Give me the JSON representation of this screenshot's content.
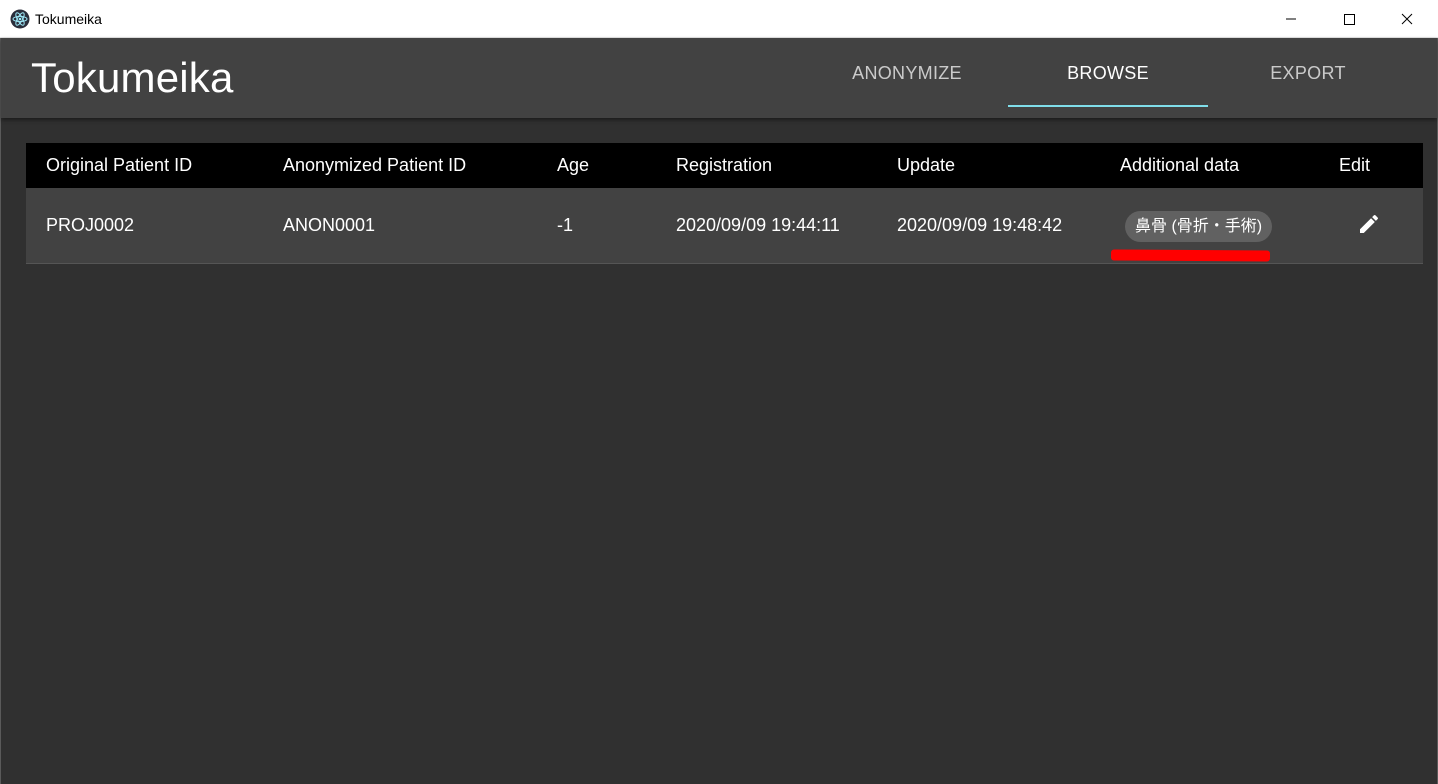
{
  "window": {
    "title": "Tokumeika",
    "icon": "electron-atom-icon",
    "controls": [
      "minimize",
      "maximize",
      "close"
    ]
  },
  "header": {
    "brand": "Tokumeika",
    "tabs": [
      {
        "label": "ANONYMIZE",
        "active": false
      },
      {
        "label": "BROWSE",
        "active": true
      },
      {
        "label": "EXPORT",
        "active": false
      }
    ],
    "indicator_color": "#80deea"
  },
  "table": {
    "columns": [
      "Original Patient ID",
      "Anonymized Patient ID",
      "Age",
      "Registration",
      "Update",
      "Additional data",
      "Edit"
    ],
    "rows": [
      {
        "original_id": "PROJ0002",
        "anonymized_id": "ANON0001",
        "age": "-1",
        "registration": "2020/09/09 19:44:11",
        "update": "2020/09/09 19:48:42",
        "additional_data": [
          "鼻骨 (骨折・手術)"
        ],
        "edit_icon": "pencil-icon"
      }
    ]
  },
  "colors": {
    "background": "#303030",
    "appbar": "#424242",
    "table_header": "#000000",
    "chip": "#616161",
    "annotation": "#ff0000"
  }
}
